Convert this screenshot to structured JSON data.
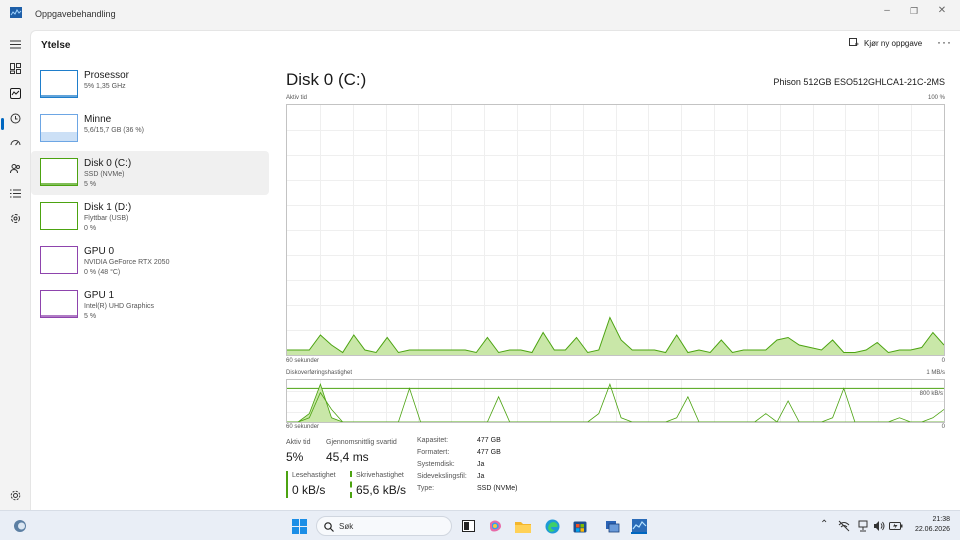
{
  "window": {
    "title": "Oppgavebehandling",
    "buttons": [
      "minimize",
      "maximize",
      "close"
    ]
  },
  "nav": {
    "items": [
      {
        "name": "menu-icon"
      },
      {
        "name": "processes-icon"
      },
      {
        "name": "performance-icon",
        "active": true
      },
      {
        "name": "app-history-icon"
      },
      {
        "name": "startup-icon"
      },
      {
        "name": "users-icon"
      },
      {
        "name": "details-icon"
      },
      {
        "name": "services-icon"
      }
    ],
    "settings_icon": "gear-icon"
  },
  "header": {
    "title": "Ytelse",
    "run_task_label": "Kjør ny oppgave",
    "more_label": "···"
  },
  "resources": [
    {
      "name": "Prosessor",
      "lines": [
        "5%  1,35 GHz"
      ],
      "color": "#1f7ecb",
      "utilization": 0.05
    },
    {
      "name": "Minne",
      "lines": [
        "5,6/15,7 GB (36 %)"
      ],
      "color": "#6da6e4",
      "utilization": 0.36
    },
    {
      "name": "Disk 0 (C:)",
      "lines": [
        "SSD (NVMe)",
        "5 %"
      ],
      "color": "#4ca311",
      "selected": true,
      "utilization": 0.05
    },
    {
      "name": "Disk 1 (D:)",
      "lines": [
        "Flyttbar (USB)",
        "0 %"
      ],
      "color": "#4ca311",
      "utilization": 0.0
    },
    {
      "name": "GPU 0",
      "lines": [
        "NVIDIA GeForce RTX 2050",
        "0 % (48 °C)"
      ],
      "color": "#8e44ad",
      "utilization": 0.0
    },
    {
      "name": "GPU 1",
      "lines": [
        "Intel(R) UHD Graphics",
        "5 %"
      ],
      "color": "#8e44ad",
      "utilization": 0.05
    }
  ],
  "detail": {
    "title": "Disk 0 (C:)",
    "model": "Phison 512GB ESO512GHLCA1-21C-2MS",
    "graph1": {
      "label": "Aktiv tid",
      "max": "100 %",
      "time": "60 sekunder",
      "min": "0",
      "values": [
        2,
        2,
        2,
        8,
        4,
        1,
        8,
        2,
        1,
        7,
        1,
        2,
        2,
        2,
        2,
        2,
        2,
        1,
        7,
        1,
        2,
        2,
        1,
        9,
        2,
        2,
        7,
        1,
        2,
        15,
        6,
        2,
        2,
        2,
        1,
        8,
        1,
        2,
        1,
        6,
        1,
        2,
        2,
        2,
        6,
        7,
        4,
        3,
        2,
        6,
        1,
        1,
        2,
        5,
        1,
        2,
        2,
        3,
        9,
        4
      ]
    },
    "graph2": {
      "label": "Diskoverføringshastighet",
      "max": "1 MB/s",
      "ref_label": "800 kB/s",
      "time": "60 sekunder",
      "min": "0",
      "read_values": [
        0,
        0,
        0.2,
        0.9,
        0.1,
        0,
        0,
        0,
        0,
        0,
        0,
        0,
        0,
        0,
        0,
        0,
        0,
        0,
        0,
        0,
        0,
        0,
        0,
        0,
        0,
        0,
        0,
        0,
        0,
        0,
        0,
        0,
        0,
        0,
        0,
        0,
        0,
        0,
        0,
        0,
        0,
        0,
        0,
        0,
        0,
        0,
        0,
        0,
        0,
        0,
        0,
        0,
        0,
        0,
        0,
        0,
        0,
        0,
        0,
        0
      ],
      "write_values": [
        0,
        0,
        0.1,
        0.7,
        0.3,
        0,
        0,
        0,
        0,
        0,
        0,
        0.8,
        0,
        0,
        0,
        0,
        0,
        0,
        0,
        0.6,
        0,
        0,
        0,
        0,
        0,
        0,
        0,
        0,
        0.2,
        0.9,
        0.1,
        0,
        0,
        0,
        0,
        0.1,
        0.6,
        0,
        0,
        0,
        0,
        0,
        0,
        0.2,
        0,
        0.5,
        0,
        0,
        0,
        0.1,
        0.8,
        0,
        0,
        0,
        0,
        0.1,
        0,
        0,
        0.1,
        0.3
      ]
    },
    "stats": {
      "active_time_label": "Aktiv tid",
      "active_time_value": "5%",
      "response_label": "Gjennomsnittlig svartid",
      "response_value": "45,4 ms",
      "read_label": "Lesehastighet",
      "read_value": "0 kB/s",
      "write_label": "Skrivehastighet",
      "write_value": "65,6 kB/s"
    },
    "properties": [
      {
        "key": "Kapasitet:",
        "value": "477 GB"
      },
      {
        "key": "Formatert:",
        "value": "477 GB"
      },
      {
        "key": "Systemdisk:",
        "value": "Ja"
      },
      {
        "key": "Sidevekslingsfil:",
        "value": "Ja"
      },
      {
        "key": "Type:",
        "value": "SSD (NVMe)"
      }
    ]
  },
  "taskbar": {
    "search_placeholder": "Søk",
    "time": "21:38",
    "date": "22.06.2026"
  },
  "colors": {
    "disk_green": "#4ca311",
    "disk_fill": "#c9e7a8",
    "accent": "#0067c0"
  }
}
